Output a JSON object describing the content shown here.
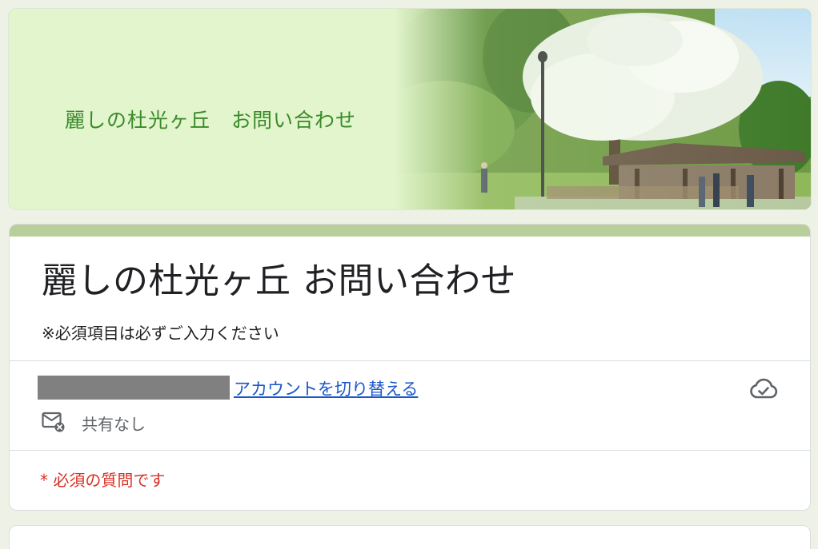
{
  "banner": {
    "title": "麗しの杜光ヶ丘　お問い合わせ"
  },
  "form": {
    "title": "麗しの杜光ヶ丘 お問い合わせ",
    "note": "※必須項目は必ずご入力ください"
  },
  "account": {
    "switch_label": "アカウントを切り替える",
    "sharing_label": "共有なし"
  },
  "required_notice": "* 必須の質問です",
  "colors": {
    "accent_bar": "#b9cf9b",
    "banner_bg": "#e2f5cc",
    "banner_text": "#3b8a2b",
    "link": "#1a56c9",
    "required": "#d93025",
    "page_bg": "#eef2e6"
  },
  "icons": {
    "cloud": "cloud-check-icon",
    "mail": "mail-off-icon"
  }
}
